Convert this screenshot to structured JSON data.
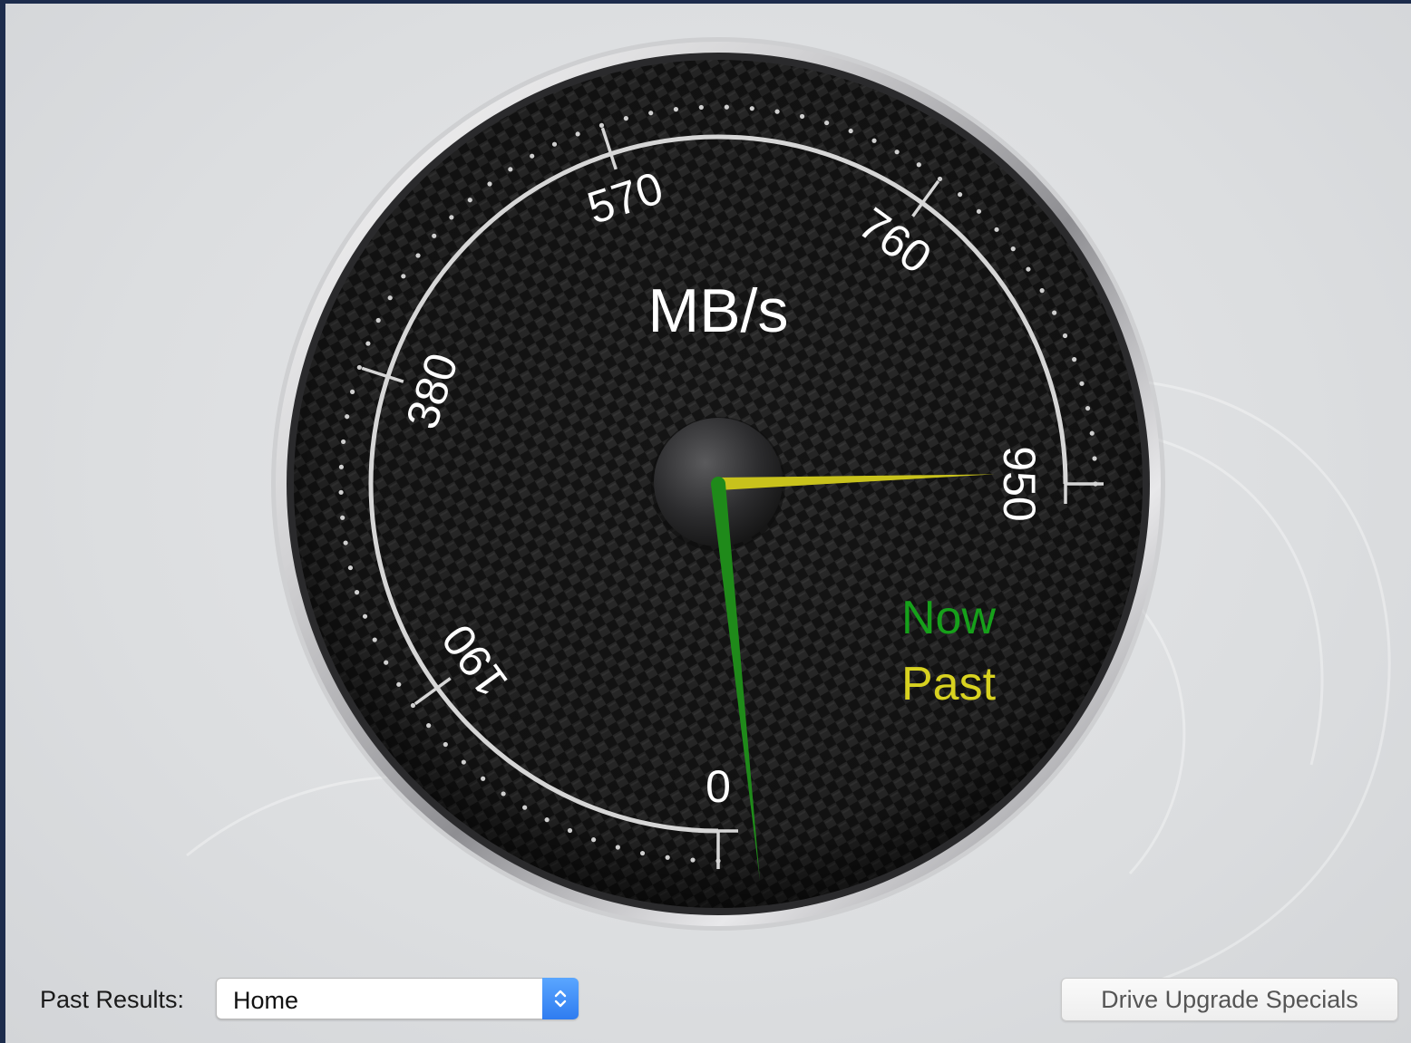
{
  "gauge": {
    "unit": "MB/s",
    "scale_min": 0,
    "scale_max": 950,
    "tick_labels": [
      "0",
      "190",
      "380",
      "570",
      "760",
      "950"
    ],
    "now_value": 0,
    "past_value": 950,
    "legend": {
      "now_label": "Now",
      "past_label": "Past",
      "now_color": "#16a01a",
      "past_color": "#d8d220"
    }
  },
  "controls": {
    "past_results_label": "Past Results:",
    "past_results_value": "Home",
    "upgrade_button_label": "Drive Upgrade Specials"
  },
  "colors": {
    "window_border": "#1d2c4c",
    "accent_blue": "#2f7cf0"
  }
}
